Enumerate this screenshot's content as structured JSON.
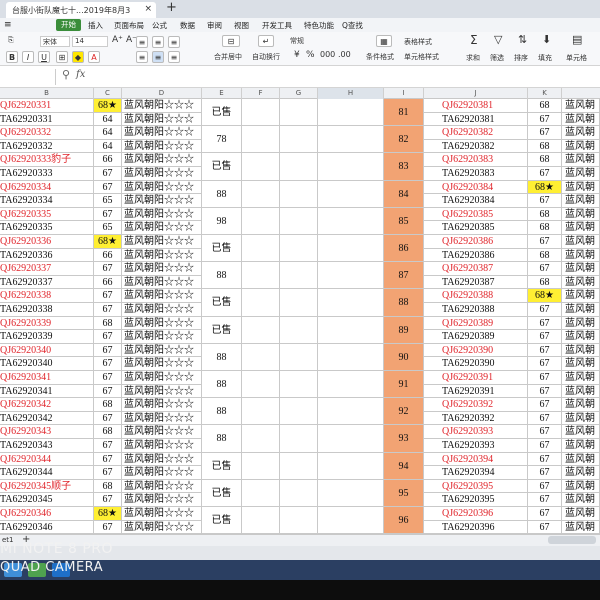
{
  "window": {
    "tab_title": "台服小街队魔七十...2019年8月3",
    "new_tab_icon": "plus-icon"
  },
  "menu": {
    "items": [
      "开始",
      "插入",
      "页面布局",
      "公式",
      "数据",
      "审阅",
      "视图",
      "开发工具",
      "特色功能"
    ],
    "search_label": "Q查找"
  },
  "ribbon": {
    "font_name": "宋体",
    "font_size": "14",
    "wrap_label": "自动换行",
    "merge_label": "合并居中",
    "number_format": "常规",
    "cond_format": "条件格式",
    "table_style": "表格样式",
    "cell_style": "单元格样式",
    "sum_label": "求和",
    "filter_label": "筛选",
    "sort_label": "排序",
    "fill_label": "填充",
    "cell_label": "单元格",
    "percent_symbol": "%"
  },
  "formula_bar": {
    "fx_label": "fx",
    "value": ""
  },
  "columns": [
    "B",
    "C",
    "D",
    "E",
    "F",
    "G",
    "H",
    "I",
    "J",
    "K"
  ],
  "left_rows": [
    {
      "code": "QJ62920331",
      "red": true,
      "c": "68★",
      "yellow": true,
      "d": "蓝风朝阳☆☆☆"
    },
    {
      "code": "TA62920331",
      "red": false,
      "c": "64",
      "yellow": false,
      "d": "蓝风朝阳☆☆☆"
    },
    {
      "code": "QJ62920332",
      "red": true,
      "c": "64",
      "yellow": false,
      "d": "蓝风朝阳☆☆☆"
    },
    {
      "code": "TA62920332",
      "red": false,
      "c": "64",
      "yellow": false,
      "d": "蓝风朝阳☆☆☆"
    },
    {
      "code": "QJ62920333豹子",
      "red": true,
      "c": "66",
      "yellow": false,
      "d": "蓝风朝阳☆☆☆"
    },
    {
      "code": "TA62920333",
      "red": false,
      "c": "67",
      "yellow": false,
      "d": "蓝风朝阳☆☆☆"
    },
    {
      "code": "QJ62920334",
      "red": true,
      "c": "67",
      "yellow": false,
      "d": "蓝风朝阳☆☆☆"
    },
    {
      "code": "TA62920334",
      "red": false,
      "c": "65",
      "yellow": false,
      "d": "蓝风朝阳☆☆☆"
    },
    {
      "code": "QJ62920335",
      "red": true,
      "c": "67",
      "yellow": false,
      "d": "蓝风朝阳☆☆☆"
    },
    {
      "code": "TA62920335",
      "red": false,
      "c": "65",
      "yellow": false,
      "d": "蓝风朝阳☆☆☆"
    },
    {
      "code": "QJ62920336",
      "red": true,
      "c": "68★",
      "yellow": true,
      "d": "蓝风朝阳☆☆☆"
    },
    {
      "code": "TA62920336",
      "red": false,
      "c": "66",
      "yellow": false,
      "d": "蓝风朝阳☆☆☆"
    },
    {
      "code": "QJ62920337",
      "red": true,
      "c": "67",
      "yellow": false,
      "d": "蓝风朝阳☆☆☆"
    },
    {
      "code": "TA62920337",
      "red": false,
      "c": "66",
      "yellow": false,
      "d": "蓝风朝阳☆☆☆"
    },
    {
      "code": "QJ62920338",
      "red": true,
      "c": "67",
      "yellow": false,
      "d": "蓝风朝阳☆☆☆"
    },
    {
      "code": "TA62920338",
      "red": false,
      "c": "67",
      "yellow": false,
      "d": "蓝风朝阳☆☆☆"
    },
    {
      "code": "QJ62920339",
      "red": true,
      "c": "68",
      "yellow": false,
      "d": "蓝风朝阳☆☆☆"
    },
    {
      "code": "TA62920339",
      "red": false,
      "c": "67",
      "yellow": false,
      "d": "蓝风朝阳☆☆☆"
    },
    {
      "code": "QJ62920340",
      "red": true,
      "c": "67",
      "yellow": false,
      "d": "蓝风朝阳☆☆☆"
    },
    {
      "code": "TA62920340",
      "red": false,
      "c": "67",
      "yellow": false,
      "d": "蓝风朝阳☆☆☆"
    },
    {
      "code": "QJ62920341",
      "red": true,
      "c": "67",
      "yellow": false,
      "d": "蓝风朝阳☆☆☆"
    },
    {
      "code": "TA62920341",
      "red": false,
      "c": "67",
      "yellow": false,
      "d": "蓝风朝阳☆☆☆"
    },
    {
      "code": "QJ62920342",
      "red": true,
      "c": "68",
      "yellow": false,
      "d": "蓝风朝阳☆☆☆"
    },
    {
      "code": "TA62920342",
      "red": false,
      "c": "67",
      "yellow": false,
      "d": "蓝风朝阳☆☆☆"
    },
    {
      "code": "QJ62920343",
      "red": true,
      "c": "68",
      "yellow": false,
      "d": "蓝风朝阳☆☆☆"
    },
    {
      "code": "TA62920343",
      "red": false,
      "c": "67",
      "yellow": false,
      "d": "蓝风朝阳☆☆☆"
    },
    {
      "code": "QJ62920344",
      "red": true,
      "c": "67",
      "yellow": false,
      "d": "蓝风朝阳☆☆☆"
    },
    {
      "code": "TA62920344",
      "red": false,
      "c": "67",
      "yellow": false,
      "d": "蓝风朝阳☆☆☆"
    },
    {
      "code": "QJ62920345顺子",
      "red": true,
      "c": "68",
      "yellow": false,
      "d": "蓝风朝阳☆☆☆"
    },
    {
      "code": "TA62920345",
      "red": false,
      "c": "67",
      "yellow": false,
      "d": "蓝风朝阳☆☆☆"
    },
    {
      "code": "QJ62920346",
      "red": true,
      "c": "68★",
      "yellow": true,
      "d": "蓝风朝阳☆☆☆"
    },
    {
      "code": "TA62920346",
      "red": false,
      "c": "67",
      "yellow": false,
      "d": "蓝风朝阳☆☆☆"
    }
  ],
  "e_values": [
    "已售",
    "78",
    "已售",
    "88",
    "98",
    "已售",
    "88",
    "已售",
    "已售",
    "88",
    "88",
    "88",
    "88",
    "已售",
    "已售",
    "已售"
  ],
  "i_values": [
    "81",
    "82",
    "83",
    "84",
    "85",
    "86",
    "87",
    "88",
    "89",
    "90",
    "91",
    "92",
    "93",
    "94",
    "95",
    "96"
  ],
  "right_rows": [
    {
      "code": "QJ62920381",
      "red": true,
      "k": "68",
      "yellow": false,
      "l": "蓝风朝"
    },
    {
      "code": "TA62920381",
      "red": false,
      "k": "67",
      "yellow": false,
      "l": "蓝风朝"
    },
    {
      "code": "QJ62920382",
      "red": true,
      "k": "67",
      "yellow": false,
      "l": "蓝风朝"
    },
    {
      "code": "TA62920382",
      "red": false,
      "k": "68",
      "yellow": false,
      "l": "蓝风朝"
    },
    {
      "code": "QJ62920383",
      "red": true,
      "k": "68",
      "yellow": false,
      "l": "蓝风朝"
    },
    {
      "code": "TA62920383",
      "red": false,
      "k": "67",
      "yellow": false,
      "l": "蓝风朝"
    },
    {
      "code": "QJ62920384",
      "red": true,
      "k": "68★",
      "yellow": true,
      "l": "蓝风朝"
    },
    {
      "code": "TA62920384",
      "red": false,
      "k": "67",
      "yellow": false,
      "l": "蓝风朝"
    },
    {
      "code": "QJ62920385",
      "red": true,
      "k": "68",
      "yellow": false,
      "l": "蓝风朝"
    },
    {
      "code": "TA62920385",
      "red": false,
      "k": "68",
      "yellow": false,
      "l": "蓝风朝"
    },
    {
      "code": "QJ62920386",
      "red": true,
      "k": "67",
      "yellow": false,
      "l": "蓝风朝"
    },
    {
      "code": "TA62920386",
      "red": false,
      "k": "68",
      "yellow": false,
      "l": "蓝风朝"
    },
    {
      "code": "QJ62920387",
      "red": true,
      "k": "67",
      "yellow": false,
      "l": "蓝风朝"
    },
    {
      "code": "TA62920387",
      "red": false,
      "k": "68",
      "yellow": false,
      "l": "蓝风朝"
    },
    {
      "code": "QJ62920388",
      "red": true,
      "k": "68★",
      "yellow": true,
      "l": "蓝风朝"
    },
    {
      "code": "TA62920388",
      "red": false,
      "k": "67",
      "yellow": false,
      "l": "蓝风朝"
    },
    {
      "code": "QJ62920389",
      "red": true,
      "k": "67",
      "yellow": false,
      "l": "蓝风朝"
    },
    {
      "code": "TA62920389",
      "red": false,
      "k": "67",
      "yellow": false,
      "l": "蓝风朝"
    },
    {
      "code": "QJ62920390",
      "red": true,
      "k": "67",
      "yellow": false,
      "l": "蓝风朝"
    },
    {
      "code": "TA62920390",
      "red": false,
      "k": "67",
      "yellow": false,
      "l": "蓝风朝"
    },
    {
      "code": "QJ62920391",
      "red": true,
      "k": "67",
      "yellow": false,
      "l": "蓝风朝"
    },
    {
      "code": "TA62920391",
      "red": false,
      "k": "67",
      "yellow": false,
      "l": "蓝风朝"
    },
    {
      "code": "QJ62920392",
      "red": true,
      "k": "67",
      "yellow": false,
      "l": "蓝风朝"
    },
    {
      "code": "TA62920392",
      "red": false,
      "k": "67",
      "yellow": false,
      "l": "蓝风朝"
    },
    {
      "code": "QJ62920393",
      "red": true,
      "k": "67",
      "yellow": false,
      "l": "蓝风朝"
    },
    {
      "code": "TA62920393",
      "red": false,
      "k": "67",
      "yellow": false,
      "l": "蓝风朝"
    },
    {
      "code": "QJ62920394",
      "red": true,
      "k": "67",
      "yellow": false,
      "l": "蓝风朝"
    },
    {
      "code": "TA62920394",
      "red": false,
      "k": "67",
      "yellow": false,
      "l": "蓝风朝"
    },
    {
      "code": "QJ62920395",
      "red": true,
      "k": "67",
      "yellow": false,
      "l": "蓝风朝"
    },
    {
      "code": "TA62920395",
      "red": false,
      "k": "67",
      "yellow": false,
      "l": "蓝风朝"
    },
    {
      "code": "QJ62920396",
      "red": true,
      "k": "67",
      "yellow": false,
      "l": "蓝风朝"
    },
    {
      "code": "TA62920396",
      "red": false,
      "k": "67",
      "yellow": false,
      "l": "蓝风朝"
    }
  ],
  "sheet": {
    "tab_label": "et1",
    "add_icon": "plus-icon"
  },
  "watermark": {
    "line1": "MI NOTE 8 PRO",
    "line2": "QUAD CAMERA"
  },
  "colors": {
    "red_text": "#e0242a",
    "highlight_yellow": "#ffef33",
    "sale_column": "#f2a373",
    "start_tab": "#3a8d3a"
  }
}
